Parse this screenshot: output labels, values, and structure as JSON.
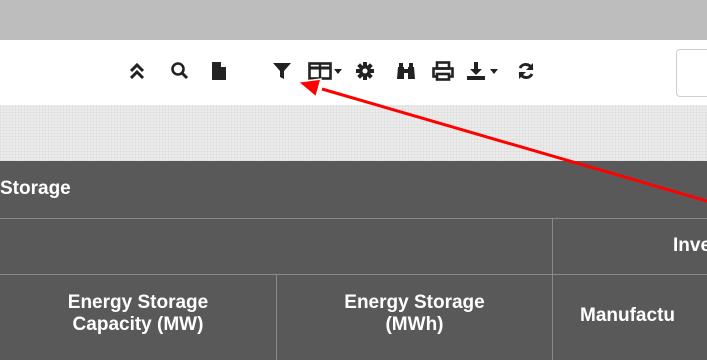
{
  "toolbar": {
    "icons": [
      {
        "name": "collapse-icon"
      },
      {
        "name": "search-icon"
      },
      {
        "name": "document-icon"
      },
      {
        "name": "filter-icon"
      },
      {
        "name": "columns-icon"
      },
      {
        "name": "gear-icon"
      },
      {
        "name": "binoculars-icon"
      },
      {
        "name": "print-icon"
      },
      {
        "name": "download-icon"
      },
      {
        "name": "refresh-icon"
      }
    ]
  },
  "grid": {
    "title": "Storage",
    "group_header": "Inve",
    "columns": {
      "col1_line1": "Energy Storage",
      "col1_line2": "Capacity (MW)",
      "col2_line1": "Energy Storage",
      "col2_line2": "(MWh)",
      "col3": "Manufactu"
    }
  },
  "annotation": {
    "arrow_color": "#ff0000"
  }
}
